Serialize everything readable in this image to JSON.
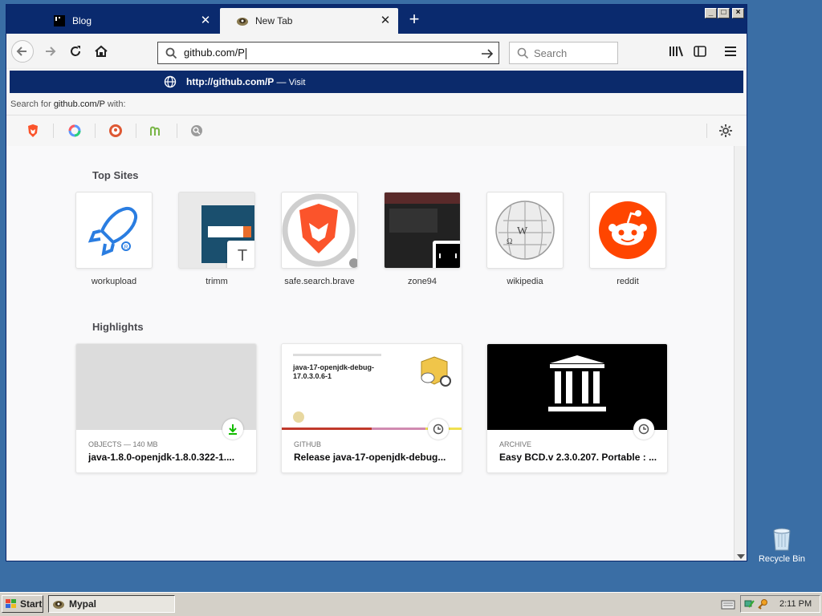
{
  "browser": {
    "tabs": [
      {
        "label": "Blog",
        "icon": "blog-favicon-icon"
      },
      {
        "label": "New Tab",
        "icon": "mypal-icon"
      }
    ],
    "address": {
      "value": "github.com/P"
    },
    "search_placeholder": "Search",
    "suggestion": {
      "url": "http://github.com/P",
      "separator": "—",
      "action": "Visit"
    },
    "search_for": {
      "prefix": "Search for ",
      "query": "github.com/P",
      "suffix": " with:"
    },
    "engines": [
      "brave-icon",
      "qwant-icon",
      "duckduckgo-icon",
      "mojeek-icon",
      "search-icon"
    ]
  },
  "newtab": {
    "top_sites_title": "Top Sites",
    "top_sites": [
      {
        "label": "workupload"
      },
      {
        "label": "trimm",
        "badge": "T"
      },
      {
        "label": "safe.search.brave"
      },
      {
        "label": "zone94"
      },
      {
        "label": "wikipedia"
      },
      {
        "label": "reddit"
      }
    ],
    "highlights_title": "Highlights",
    "highlights": [
      {
        "context": "OBJECTS — 140 MB",
        "title": "java-1.8.0-openjdk-1.8.0.322-1....",
        "badge": "download-icon"
      },
      {
        "context": "GITHUB",
        "title": "Release java-17-openjdk-debug...",
        "badge": "clock-icon",
        "preview_title": "java-17-openjdk-debug-17.0.3.0.6-1"
      },
      {
        "context": "ARCHIVE",
        "title": "Easy BCD.v 2.3.0.207. Portable : ...",
        "badge": "clock-icon"
      }
    ]
  },
  "desktop": {
    "recycle_bin": "Recycle Bin"
  },
  "taskbar": {
    "start": "Start",
    "task": "Mypal",
    "clock": "2:11 PM"
  },
  "colors": {
    "tabstrip": "#0a2a6e",
    "suggestion": "#0b2a6b",
    "desktop": "#3a6ea5",
    "reddit": "#ff4500",
    "brave": "#fb542b"
  }
}
